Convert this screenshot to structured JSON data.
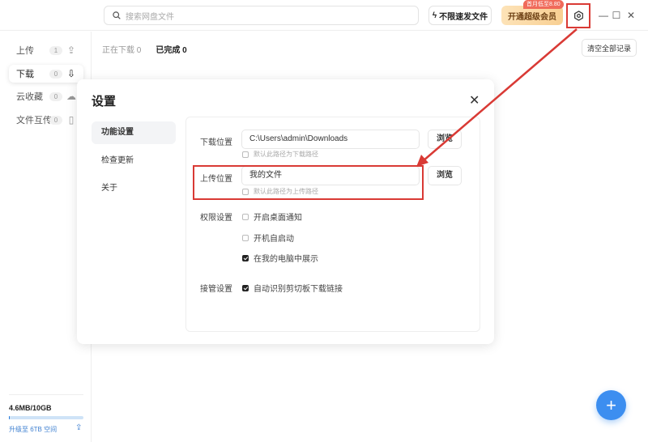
{
  "topbar": {
    "search_placeholder": "搜索网盘文件",
    "fast_label": "不限速发文件",
    "vip_label": "开通超级会员",
    "vip_badge": "首月低至8.80"
  },
  "sidebar": {
    "items": [
      {
        "label": "上传",
        "count": "1"
      },
      {
        "label": "下载",
        "count": "0"
      },
      {
        "label": "云收藏",
        "count": "0"
      },
      {
        "label": "文件互传",
        "count": "0"
      }
    ],
    "storage": "4.6MB/10GB",
    "storage_used_fraction": 0.0005,
    "upgrade": "升级至 6TB 空间"
  },
  "main": {
    "tab_downloading": "正在下载",
    "tab_downloading_count": "0",
    "tab_done": "已完成",
    "tab_done_count": "0",
    "clear_label": "清空全部记录"
  },
  "dialog": {
    "title": "设置",
    "nav": [
      "功能设置",
      "检查更新",
      "关于"
    ],
    "download_label": "下载位置",
    "download_path": "C:\\Users\\admin\\Downloads",
    "download_default": "默认此路径为下载路径",
    "upload_label": "上传位置",
    "upload_path": "我的文件",
    "upload_default": "默认此路径为上传路径",
    "browse": "浏览",
    "perm_label": "权限设置",
    "perm_options": [
      "开启桌面通知",
      "开机自启动",
      "在我的电脑中展示"
    ],
    "takeover_label": "接管设置",
    "takeover_option": "自动识别剪切板下载链接"
  },
  "colors": {
    "accent": "#3c8ef0",
    "annotation": "#d93a35"
  }
}
